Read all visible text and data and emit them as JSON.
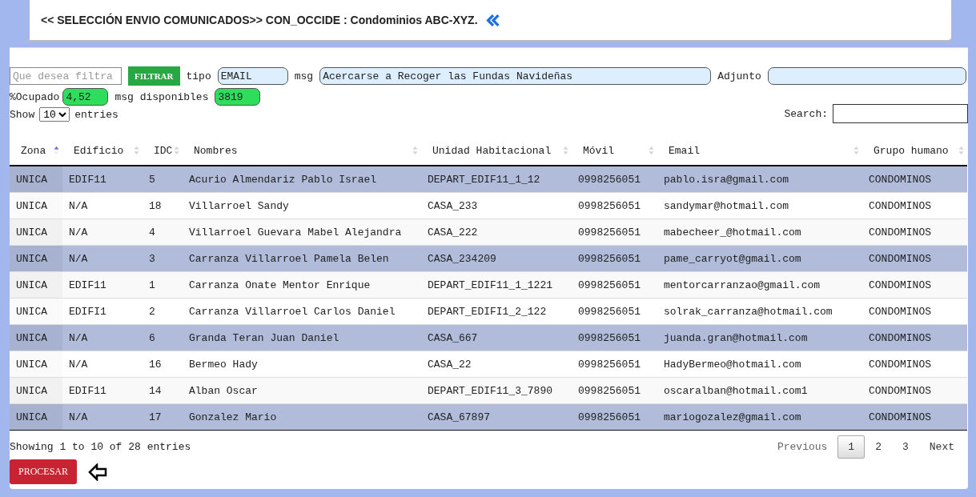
{
  "header": {
    "title": "<< SELECCIÓN ENVIO COMUNICADOS>> CON_OCCIDE : Condominios ABC-XYZ."
  },
  "filter": {
    "placeholder": "Que desea filtra",
    "button": "FILTRAR",
    "tipo_label": "tipo",
    "tipo": "EMAIL",
    "msg_label": "msg",
    "msg": "Acercarse a Recoger las Fundas Navideñas",
    "adjunto_label": "Adjunto"
  },
  "usage": {
    "ocupado_label": "%Ocupado",
    "ocupado": "4,52",
    "disponibles_label": "msg disponibles",
    "disponibles": "3819"
  },
  "length": {
    "show": "Show",
    "value": "10",
    "entries": "entries"
  },
  "search": {
    "label": "Search:"
  },
  "table": {
    "columns": [
      {
        "label": "Zona",
        "sorted": true
      },
      {
        "label": "Edificio",
        "sorted": false
      },
      {
        "label": "IDC",
        "sorted": false
      },
      {
        "label": "Nombres",
        "sorted": false
      },
      {
        "label": "Unidad Habitacional",
        "sorted": false
      },
      {
        "label": "Móvil",
        "sorted": false
      },
      {
        "label": "Email",
        "sorted": false
      },
      {
        "label": "Grupo humano",
        "sorted": false
      }
    ],
    "rows": [
      {
        "selected": true,
        "cells": [
          "UNICA",
          "EDIF11",
          "5",
          "Acurio Almendariz Pablo Israel",
          "DEPART_EDIF11_1_12",
          "0998256051",
          "pablo.isra@gmail.com",
          "CONDOMINOS"
        ]
      },
      {
        "selected": false,
        "cells": [
          "UNICA",
          "N/A",
          "18",
          "Villarroel Sandy",
          "CASA_233",
          "0998256051",
          "sandymar@hotmail.com",
          "CONDOMINOS"
        ]
      },
      {
        "selected": false,
        "cells": [
          "UNICA",
          "N/A",
          "4",
          "Villarroel Guevara Mabel Alejandra",
          "CASA_222",
          "0998256051",
          "mabecheer_@hotmail.com",
          "CONDOMINOS"
        ]
      },
      {
        "selected": true,
        "cells": [
          "UNICA",
          "N/A",
          "3",
          "Carranza Villarroel Pamela Belen",
          "CASA_234209",
          "0998256051",
          "pame_carryot@gmail.com",
          "CONDOMINOS"
        ]
      },
      {
        "selected": false,
        "cells": [
          "UNICA",
          "EDIF11",
          "1",
          "Carranza Onate Mentor Enrique",
          "DEPART_EDIF11_1_1221",
          "0998256051",
          "mentorcarranzao@gmail.com",
          "CONDOMINOS"
        ]
      },
      {
        "selected": false,
        "cells": [
          "UNICA",
          "EDIFI1",
          "2",
          "Carranza Villarroel Carlos Daniel",
          "DEPART_EDIFI1_2_122",
          "0998256051",
          "solrak_carranza@hotmail.com",
          "CONDOMINOS"
        ]
      },
      {
        "selected": true,
        "cells": [
          "UNICA",
          "N/A",
          "6",
          "Granda Teran Juan Daniel",
          "CASA_667",
          "0998256051",
          "juanda.gran@hotmail.com",
          "CONDOMINOS"
        ]
      },
      {
        "selected": false,
        "cells": [
          "UNICA",
          "N/A",
          "16",
          "Bermeo Hady",
          "CASA_22",
          "0998256051",
          "HadyBermeo@hotmail.com",
          "CONDOMINOS"
        ]
      },
      {
        "selected": false,
        "cells": [
          "UNICA",
          "EDIF11",
          "14",
          "Alban Oscar",
          "DEPART_EDIF11_3_7890",
          "0998256051",
          "oscaralban@hotmail.com1",
          "CONDOMINOS"
        ]
      },
      {
        "selected": true,
        "cells": [
          "UNICA",
          "N/A",
          "17",
          "Gonzalez Mario",
          "CASA_67897",
          "0998256051",
          "mariogozalez@gmail.com",
          "CONDOMINOS"
        ]
      }
    ]
  },
  "info": "Showing 1 to 10 of 28 entries",
  "pagination": {
    "previous": "Previous",
    "pages": [
      {
        "label": "1",
        "selected": true
      },
      {
        "label": "2",
        "selected": false
      },
      {
        "label": "3",
        "selected": false
      }
    ],
    "next": "Next"
  },
  "process_button": "PROCESAR"
}
